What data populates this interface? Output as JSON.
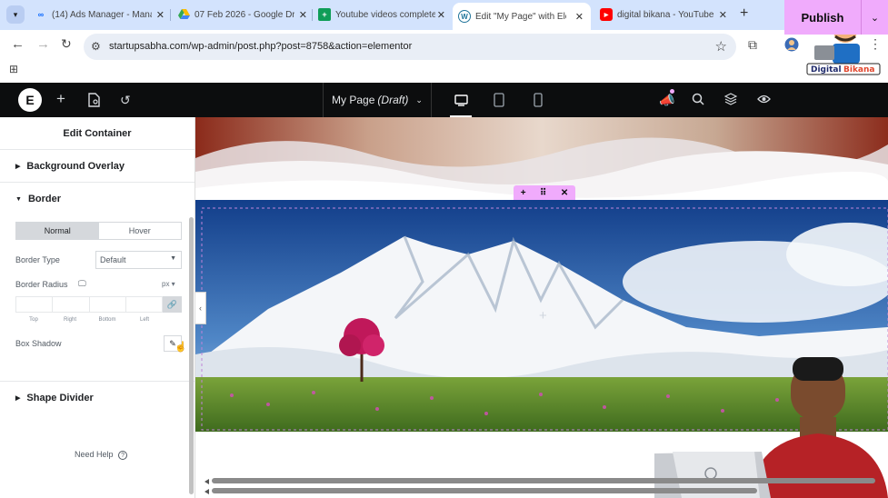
{
  "browser": {
    "tabs": [
      {
        "title": "(14) Ads Manager - Mana",
        "icon": "meta-icon"
      },
      {
        "title": "07 Feb 2026 - Google Dr",
        "icon": "google-drive-icon"
      },
      {
        "title": "Youtube videos complete",
        "icon": "google-sheets-icon"
      },
      {
        "title": "Edit \"My Page\" with Elem",
        "icon": "wordpress-icon"
      },
      {
        "title": "digital bikana - YouTube",
        "icon": "youtube-icon"
      }
    ],
    "url": "startupsabha.com/wp-admin/post.php?post=8758&action=elementor",
    "profile_text": "Digital Bikana"
  },
  "editor": {
    "page_title": "My Page",
    "page_status": "(Draft)",
    "publish_label": "Publish"
  },
  "panel": {
    "title": "Edit Container",
    "background_overlay": "Background Overlay",
    "border": "Border",
    "tabs": [
      "Normal",
      "Hover"
    ],
    "border_type_label": "Border Type",
    "border_type_value": "Default",
    "border_radius_label": "Border Radius",
    "unit": "px",
    "dims": [
      "Top",
      "Right",
      "Bottom",
      "Left"
    ],
    "box_shadow_label": "Box Shadow",
    "shape_divider": "Shape Divider",
    "need_help": "Need Help"
  },
  "colors": {
    "accent": "#f0abfc",
    "topbar": "#0c0d0e",
    "tabbar": "#d3e3fd"
  }
}
